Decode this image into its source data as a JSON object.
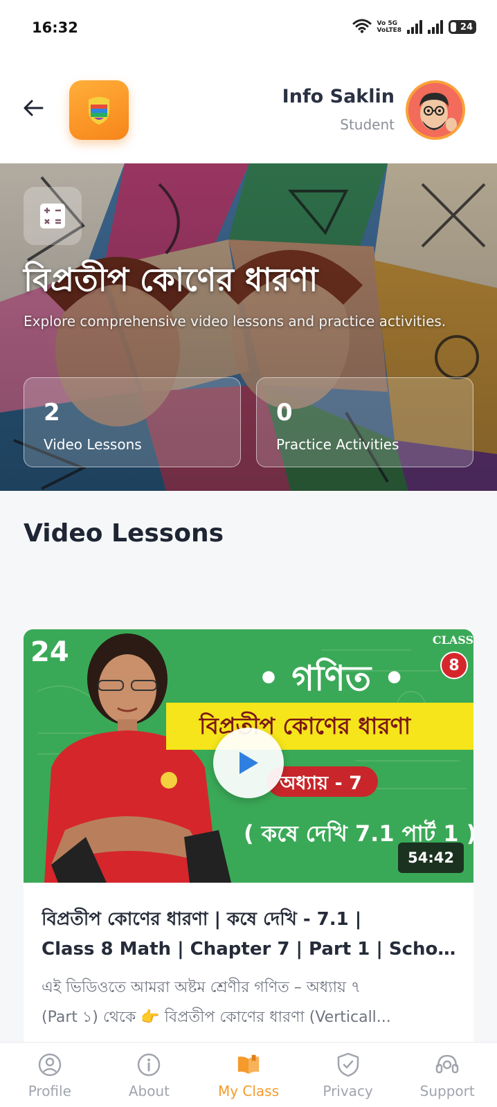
{
  "status_bar": {
    "time": "16:32",
    "network_top": "Vo 5G",
    "network_bottom": "VoLTE8",
    "battery": "24"
  },
  "header": {
    "user_name": "Info Saklin",
    "user_role": "Student",
    "icons": [
      "back-arrow-icon",
      "app-logo",
      "avatar"
    ]
  },
  "hero": {
    "title": "বিপ্রতীপ কোণের ধারণা",
    "subtitle": "Explore comprehensive video lessons and practice activities.",
    "stats": [
      {
        "value": "2",
        "label": "Video Lessons"
      },
      {
        "value": "0",
        "label": "Practice Activities"
      }
    ]
  },
  "video_section": {
    "title": "Video Lessons"
  },
  "lessons": [
    {
      "thumbnail": {
        "badge_number": "24",
        "class_label": "CLASS",
        "class_number": "8",
        "subject": "• গণিত •",
        "topic": "বিপ্রতীপ কোণের ধারণা",
        "chapter": "অধ্যায় - 7",
        "exercise": "( কষে দেখি 7.1 পার্ট 1 )"
      },
      "duration": "54:42",
      "title_line1": "বিপ্রতীপ কোণের ধারণা | কষে দেখি - 7.1 |",
      "title_line2": "Class 8 Math | Chapter 7 | Part 1 | Scho...",
      "desc_line1": "এই ভিডিওতে আমরা অষ্টম শ্রেণীর গণিত – অধ্যায় ৭",
      "desc_line2": "(Part ১) থেকে 👉 বিপ্রতীপ কোণের ধারণা (Verticall..."
    }
  ],
  "bottom_nav": [
    {
      "label": "Profile",
      "icon": "profile-icon",
      "active": false
    },
    {
      "label": "About",
      "icon": "info-icon",
      "active": false
    },
    {
      "label": "My Class",
      "icon": "book-icon",
      "active": true
    },
    {
      "label": "Privacy",
      "icon": "shield-icon",
      "active": false
    },
    {
      "label": "Support",
      "icon": "headset-icon",
      "active": false
    }
  ],
  "colors": {
    "accent": "#f59a2b",
    "nav_inactive": "#a0a4ad",
    "thumbnail_green": "#3aa957"
  }
}
